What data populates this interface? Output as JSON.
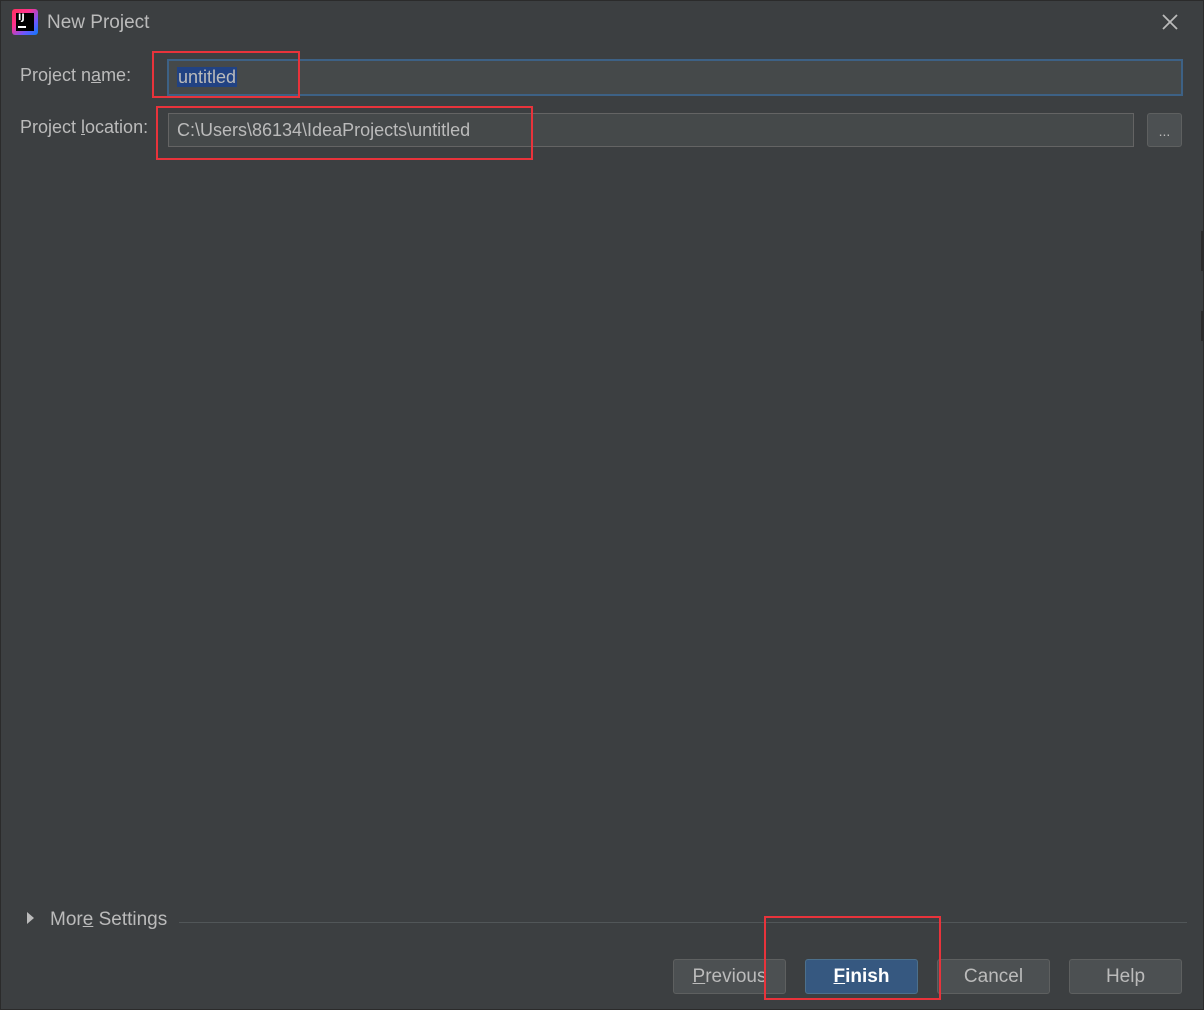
{
  "window": {
    "title": "New Project",
    "app_icon_text": "IJ"
  },
  "form": {
    "project_name": {
      "label_pre": "Project n",
      "label_mnemonic": "a",
      "label_post": "me:",
      "value": "untitled"
    },
    "project_location": {
      "label_pre": "Project ",
      "label_mnemonic": "l",
      "label_post": "ocation:",
      "value": "C:\\Users\\86134\\IdeaProjects\\untitled",
      "browse_label": "..."
    }
  },
  "more_settings": {
    "label_pre": "Mor",
    "label_mnemonic": "e",
    "label_post": " Settings"
  },
  "buttons": {
    "previous": {
      "mnemonic": "P",
      "rest": "revious"
    },
    "finish": {
      "mnemonic": "F",
      "rest": "inish"
    },
    "cancel": "Cancel",
    "help": "Help"
  },
  "colors": {
    "background": "#3c3f41",
    "field": "#45494a",
    "selection": "#214283",
    "primary_button": "#365880",
    "annotation_box": "#e8333b"
  }
}
